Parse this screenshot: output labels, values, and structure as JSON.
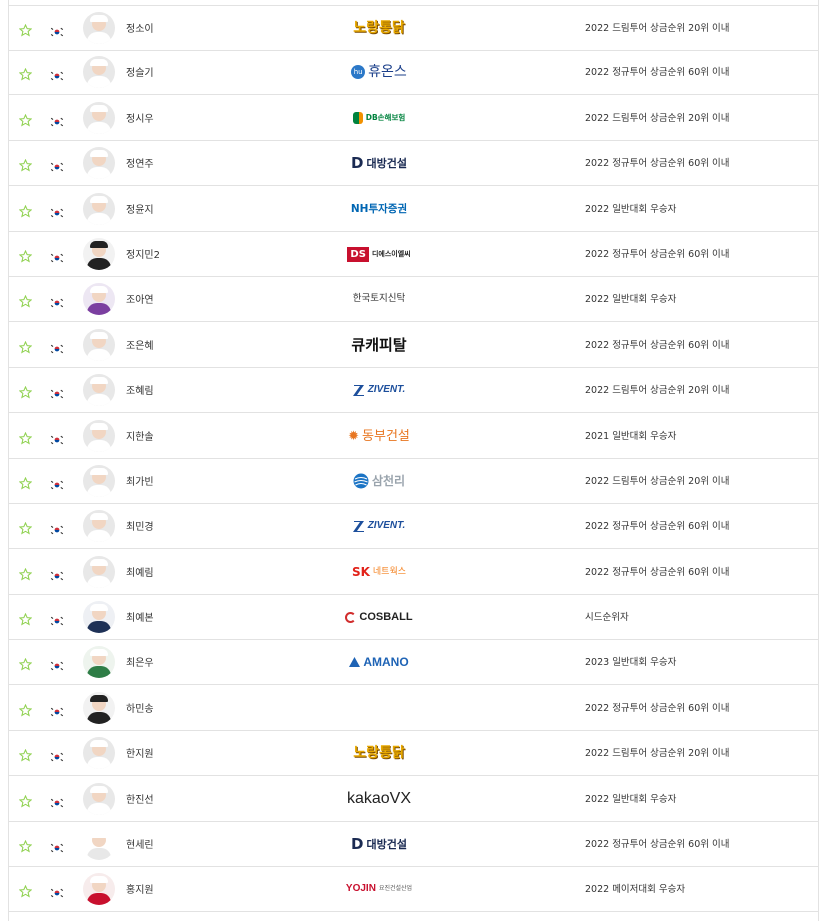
{
  "rows": [
    {
      "name": "정소이",
      "sponsor": "노랑통닭",
      "sponsor_icon": "",
      "sponsor_color": "#e8a900",
      "sponsor_accent": "",
      "qualification": "2022 드림투어 상금순위 20위 이내",
      "avatar": "cap"
    },
    {
      "name": "정슬기",
      "sponsor": "휴온스",
      "sponsor_icon": "hu",
      "sponsor_color": "#1b3f8a",
      "sponsor_accent": "#2b78c8",
      "qualification": "2022 정규투어 상금순위 60위 이내",
      "avatar": "cap"
    },
    {
      "name": "정시우",
      "sponsor": "DB손해보험",
      "sponsor_icon": "db",
      "sponsor_color": "#00833e",
      "sponsor_accent": "#f29100",
      "qualification": "2022 드림투어 상금순위 20위 이내",
      "avatar": "cap"
    },
    {
      "name": "정연주",
      "sponsor": "대방건설",
      "sponsor_icon": "D",
      "sponsor_color": "#1a2a52",
      "sponsor_accent": "",
      "qualification": "2022 정규투어 상금순위 60위 이내",
      "avatar": "cap"
    },
    {
      "name": "정윤지",
      "sponsor": "NH투자증권",
      "sponsor_icon": "",
      "sponsor_color": "#0066b3",
      "sponsor_accent": "#f2b500",
      "qualification": "2022 일반대회 우승자",
      "avatar": "cap"
    },
    {
      "name": "정지민2",
      "sponsor": "디에스이엘씨",
      "sponsor_icon": "DS",
      "sponsor_color": "#222222",
      "sponsor_accent": "#c8102e",
      "qualification": "2022 정규투어 상금순위 60위 이내",
      "avatar": "dark"
    },
    {
      "name": "조아연",
      "sponsor": "한국토지신탁",
      "sponsor_icon": "",
      "sponsor_color": "#333333",
      "sponsor_accent": "#6aa84f",
      "qualification": "2022 일반대회 우승자",
      "avatar": "purple"
    },
    {
      "name": "조은혜",
      "sponsor": "큐캐피탈",
      "sponsor_icon": "",
      "sponsor_color": "#111111",
      "sponsor_accent": "",
      "qualification": "2022 정규투어 상금순위 60위 이내",
      "avatar": "cap"
    },
    {
      "name": "조혜림",
      "sponsor": "ZIVENT.",
      "sponsor_icon": "Z",
      "sponsor_color": "#1d4f9c",
      "sponsor_accent": "",
      "qualification": "2022 드림투어 상금순위 20위 이내",
      "avatar": "cap"
    },
    {
      "name": "지한솔",
      "sponsor": "동부건설",
      "sponsor_icon": "flower",
      "sponsor_color": "#e87722",
      "sponsor_accent": "#e87722",
      "qualification": "2021 일반대회 우승자",
      "avatar": "cap"
    },
    {
      "name": "최가빈",
      "sponsor": "삼천리",
      "sponsor_icon": "globe",
      "sponsor_color": "#1b74c5",
      "sponsor_accent": "#1b74c5",
      "qualification": "2022 드림투어 상금순위 20위 이내",
      "avatar": "cap"
    },
    {
      "name": "최민경",
      "sponsor": "ZIVENT.",
      "sponsor_icon": "Z",
      "sponsor_color": "#1d4f9c",
      "sponsor_accent": "",
      "qualification": "2022 정규투어 상금순위 60위 이내",
      "avatar": "cap"
    },
    {
      "name": "최예림",
      "sponsor": "네트웍스",
      "sponsor_icon": "SK",
      "sponsor_color": "#e2231a",
      "sponsor_accent": "#f58220",
      "qualification": "2022 정규투어 상금순위 60위 이내",
      "avatar": "cap"
    },
    {
      "name": "최예본",
      "sponsor": "COSBALL",
      "sponsor_icon": "ball",
      "sponsor_color": "#222222",
      "sponsor_accent": "#d12c2c",
      "qualification": "시드순위자",
      "avatar": "navy"
    },
    {
      "name": "최은우",
      "sponsor": "AMANO",
      "sponsor_icon": "tri",
      "sponsor_color": "#1e63b5",
      "sponsor_accent": "",
      "qualification": "2023 일반대회 우승자",
      "avatar": "green"
    },
    {
      "name": "하민송",
      "sponsor": "",
      "sponsor_icon": "",
      "sponsor_color": "#333333",
      "sponsor_accent": "",
      "qualification": "2022 정규투어 상금순위 60위 이내",
      "avatar": "dark"
    },
    {
      "name": "한지원",
      "sponsor": "노랑통닭",
      "sponsor_icon": "",
      "sponsor_color": "#e8a900",
      "sponsor_accent": "",
      "qualification": "2022 드림투어 상금순위 20위 이내",
      "avatar": "cap"
    },
    {
      "name": "한진선",
      "sponsor": "kakaoVX",
      "sponsor_icon": "",
      "sponsor_color": "#222222",
      "sponsor_accent": "",
      "qualification": "2022 일반대회 우승자",
      "avatar": "cap"
    },
    {
      "name": "현세린",
      "sponsor": "대방건설",
      "sponsor_icon": "D",
      "sponsor_color": "#1a2a52",
      "sponsor_accent": "",
      "qualification": "2022 정규투어 상금순위 60위 이내",
      "avatar": "noimg"
    },
    {
      "name": "홍지원",
      "sponsor": "YOJIN",
      "sponsor_sub": "요진건설산업",
      "sponsor_icon": "",
      "sponsor_color": "#c8102e",
      "sponsor_accent": "#555555",
      "qualification": "2022 메이저대회 우승자",
      "avatar": "red"
    }
  ],
  "icons": {
    "favorite": "star-outline-icon",
    "nationality": "korea-flag-icon"
  },
  "colors": {
    "star": "#8fd14f",
    "border": "#e2e2e2",
    "text": "#333333"
  }
}
